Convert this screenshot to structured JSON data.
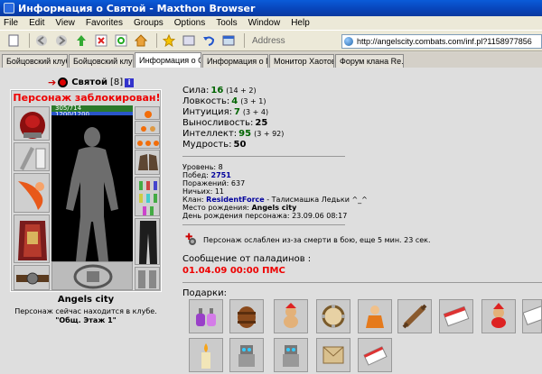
{
  "window": {
    "title": "Информация о Святой - Maxthon Browser"
  },
  "menu": [
    "File",
    "Edit",
    "View",
    "Favorites",
    "Groups",
    "Options",
    "Tools",
    "Window",
    "Help"
  ],
  "address": {
    "label": "Address",
    "url": "http://angelscity.combats.com/inf.pl?1158977856"
  },
  "tabs": [
    {
      "label": "Бойцовский клуб",
      "active": false
    },
    {
      "label": "Бойцовский клуб",
      "active": false
    },
    {
      "label": "Информация о С...",
      "active": true
    },
    {
      "label": "Информация о П...",
      "active": false
    },
    {
      "label": "Монитор Хаотов",
      "active": false
    },
    {
      "label": "Форум клана Re...",
      "active": false
    }
  ],
  "character": {
    "name": "Святой",
    "level": "[8]",
    "info_badge": "i",
    "blocked": "Персонаж заблокирован!",
    "hp": "305/714",
    "mp": "1200/1200",
    "city": "Angels city",
    "location": "Персонаж сейчас находится в клубе.",
    "room": "\"Общ. Этаж 1\""
  },
  "stats": [
    {
      "name": "Сила:",
      "value": "16",
      "bonus": "(14 + 2)",
      "color": "green"
    },
    {
      "name": "Ловкость:",
      "value": "4",
      "bonus": "(3 + 1)",
      "color": "green"
    },
    {
      "name": "Интуиция:",
      "value": "7",
      "bonus": "(3 + 4)",
      "color": "green"
    },
    {
      "name": "Выносливость:",
      "value": "25",
      "bonus": "",
      "color": "black"
    },
    {
      "name": "Интеллект:",
      "value": "95",
      "bonus": "(3 + 92)",
      "color": "green"
    },
    {
      "name": "Мудрость:",
      "value": "50",
      "bonus": "",
      "color": "black"
    }
  ],
  "info": {
    "level": "Уровень: 8",
    "wins_label": "Побед: ",
    "wins": "2751",
    "losses": "Поражений: 637",
    "draws": "Ничьих: 11",
    "clan_label": "Клан: ",
    "clan": "ResidentForce",
    "clan_rest": " - Талисмашка Ледьки ^_^",
    "birthplace_label": "Место рождения: ",
    "birthplace": "Angels city",
    "birthday": "День рождения персонажа: 23.09.06 08:17"
  },
  "weakness": "Персонаж ослаблен из-за смерти в бою, еще 5 мин. 23 сек.",
  "paladin": {
    "heading": "Сообщение от паладинов :",
    "value": "01.04.09 00:00 ПМС"
  },
  "gifts": {
    "heading": "Подарки:",
    "icons": [
      "potion-icon",
      "barrel-icon",
      "teddy-bear-icon",
      "tambourine-icon",
      "doll-icon",
      "rolling-pin-icon",
      "gift-card-icon",
      "teddy-bear-santa-icon",
      "gift-card-icon",
      "candle-icon",
      "robot-icon",
      "robot-icon",
      "letter-icon",
      "scroll-icon"
    ]
  }
}
